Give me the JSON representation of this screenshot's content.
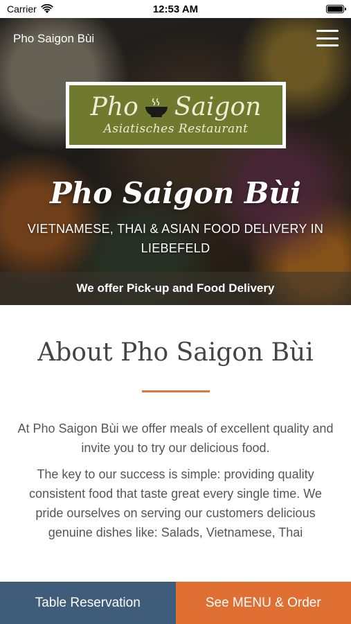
{
  "status_bar": {
    "carrier": "Carrier",
    "time": "12:53 AM",
    "wifi_icon": "wifi-icon",
    "battery_icon": "battery-icon"
  },
  "hero": {
    "brand": "Pho Saigon Bùi",
    "menu_icon": "hamburger-menu-icon",
    "logo": {
      "title_left": "Pho",
      "title_right": "Saigon",
      "subtitle": "Asiatisches Restaurant",
      "bowl_icon": "soup-bowl-icon",
      "background_color": "#6f7a2f"
    },
    "title": "Pho Saigon Bùi",
    "subtitle": "VIETNAMESE, THAI & ASIAN FOOD DELIVERY IN LIEBEFELD",
    "band_text": "We offer Pick-up and Food Delivery"
  },
  "about": {
    "title": "About Pho Saigon Bùi",
    "divider_color": "#d9773f",
    "paragraph_1": "At Pho Saigon Bùi we offer meals of excellent quality and invite you to try our delicious food.",
    "paragraph_2": "The key to our success is simple: providing quality consistent food that taste great every single time. We pride ourselves on serving our customers delicious genuine dishes like: Salads, Vietnamese, Thai"
  },
  "bottom_bar": {
    "reservation_label": "Table Reservation",
    "reservation_color": "#3f5d7a",
    "order_label": "See MENU & Order",
    "order_color": "#e06f34"
  }
}
